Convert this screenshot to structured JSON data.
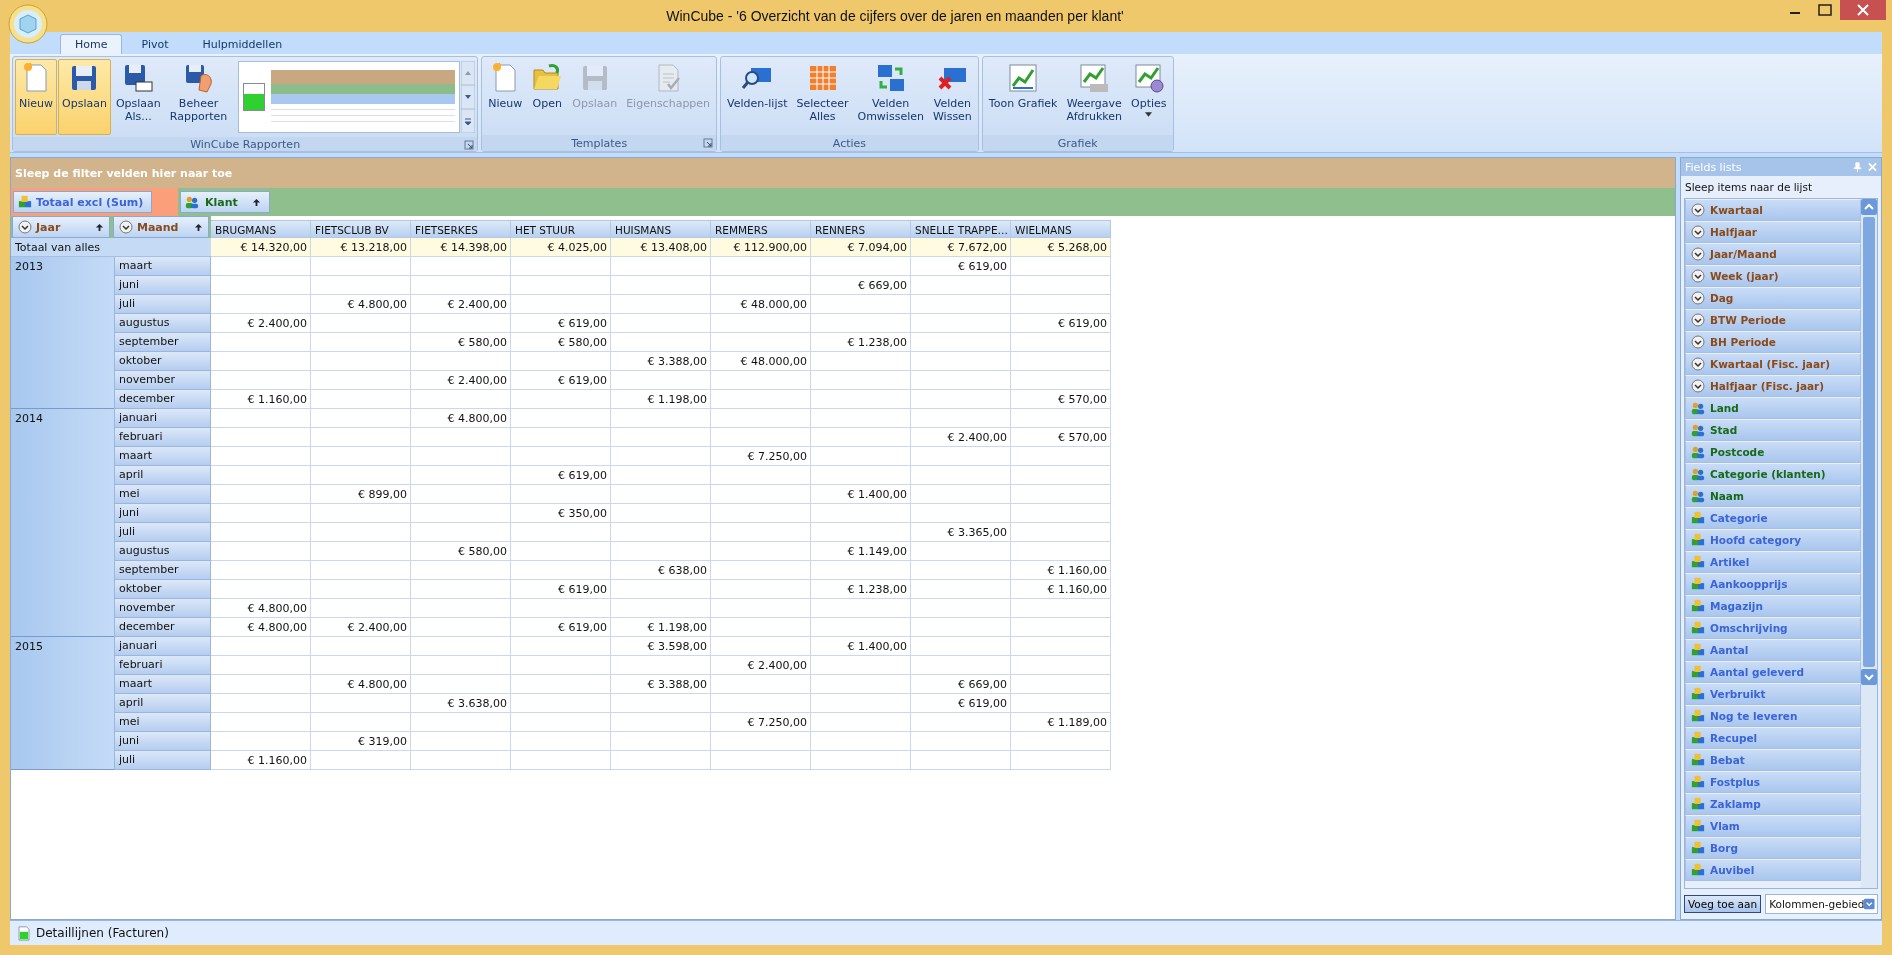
{
  "window": {
    "title": "WinCube - '6 Overzicht van de cijfers over de jaren en maanden per klant'"
  },
  "tabs": [
    {
      "label": "Home",
      "selected": true
    },
    {
      "label": "Pivot",
      "selected": false
    },
    {
      "label": "Hulpmiddellen",
      "selected": false
    }
  ],
  "ribbon_groups": [
    {
      "label": "WinCube Rapporten",
      "launcher": true,
      "buttons": [
        {
          "lines": [
            "Nieuw"
          ],
          "kind": "new",
          "highlighted": true,
          "disabled": false,
          "dropdown": false
        },
        {
          "lines": [
            "Opslaan"
          ],
          "kind": "save",
          "highlighted": true,
          "disabled": false,
          "dropdown": false
        },
        {
          "lines": [
            "Opslaan",
            "Als..."
          ],
          "kind": "saveas",
          "highlighted": false,
          "disabled": false,
          "dropdown": false
        },
        {
          "lines": [
            "Beheer",
            "Rapporten"
          ],
          "kind": "manage",
          "highlighted": false,
          "disabled": false,
          "dropdown": false
        }
      ]
    },
    {
      "label": "Templates",
      "launcher": true,
      "buttons": [
        {
          "lines": [
            "Nieuw"
          ],
          "kind": "new",
          "highlighted": false,
          "disabled": false,
          "dropdown": false
        },
        {
          "lines": [
            "Open"
          ],
          "kind": "open",
          "highlighted": false,
          "disabled": false,
          "dropdown": false
        },
        {
          "lines": [
            "Opslaan"
          ],
          "kind": "save",
          "highlighted": false,
          "disabled": true,
          "dropdown": false
        },
        {
          "lines": [
            "Eigenschappen"
          ],
          "kind": "props",
          "highlighted": false,
          "disabled": true,
          "dropdown": false
        }
      ]
    },
    {
      "label": "Acties",
      "launcher": false,
      "buttons": [
        {
          "lines": [
            "Velden-lijst"
          ],
          "kind": "find",
          "highlighted": false,
          "disabled": false,
          "dropdown": false
        },
        {
          "lines": [
            "Selecteer",
            "Alles"
          ],
          "kind": "grid",
          "highlighted": false,
          "disabled": false,
          "dropdown": false
        },
        {
          "lines": [
            "Velden",
            "Omwisselen"
          ],
          "kind": "swap",
          "highlighted": false,
          "disabled": false,
          "dropdown": false
        },
        {
          "lines": [
            "Velden",
            "Wissen"
          ],
          "kind": "clear",
          "highlighted": false,
          "disabled": false,
          "dropdown": false
        }
      ]
    },
    {
      "label": "Grafiek",
      "launcher": false,
      "buttons": [
        {
          "lines": [
            "Toon Grafiek"
          ],
          "kind": "chart",
          "highlighted": false,
          "disabled": false,
          "dropdown": false
        },
        {
          "lines": [
            "Weergave",
            "Afdrukken"
          ],
          "kind": "chartprint",
          "highlighted": false,
          "disabled": false,
          "dropdown": false
        },
        {
          "lines": [
            "Opties"
          ],
          "kind": "options",
          "highlighted": false,
          "disabled": false,
          "dropdown": true
        }
      ]
    }
  ],
  "pivot": {
    "filter_area": "Sleep de filter velden hier naar toe",
    "data_field": "Totaal excl (Sum)",
    "column_field": "Klant",
    "row_fields": [
      "Jaar",
      "Maand"
    ],
    "columns": [
      "BRUGMANS",
      "FIETSCLUB BV",
      "FIETSERKES",
      "HET STUUR",
      "HUISMANS",
      "REMMERS",
      "RENNERS",
      "SNELLE TRAPPE…",
      "WIELMANS"
    ],
    "grand_total": {
      "label": "Totaal van alles",
      "cells": [
        "€ 14.320,00",
        "€ 13.218,00",
        "€ 14.398,00",
        "€ 4.025,00",
        "€ 13.408,00",
        "€ 112.900,00",
        "€ 7.094,00",
        "€ 7.672,00",
        "€ 5.268,00"
      ]
    },
    "years": [
      {
        "year": "2013",
        "months": [
          {
            "month": "maart",
            "cells": [
              null,
              null,
              null,
              null,
              null,
              null,
              null,
              "€ 619,00",
              null
            ]
          },
          {
            "month": "juni",
            "cells": [
              null,
              null,
              null,
              null,
              null,
              null,
              "€ 669,00",
              null,
              null
            ]
          },
          {
            "month": "juli",
            "cells": [
              null,
              "€ 4.800,00",
              "€ 2.400,00",
              null,
              null,
              "€ 48.000,00",
              null,
              null,
              null
            ]
          },
          {
            "month": "augustus",
            "cells": [
              "€ 2.400,00",
              null,
              null,
              "€ 619,00",
              null,
              null,
              null,
              null,
              "€ 619,00"
            ]
          },
          {
            "month": "september",
            "cells": [
              null,
              null,
              "€ 580,00",
              "€ 580,00",
              null,
              null,
              "€ 1.238,00",
              null,
              null
            ]
          },
          {
            "month": "oktober",
            "cells": [
              null,
              null,
              null,
              null,
              "€ 3.388,00",
              "€ 48.000,00",
              null,
              null,
              null
            ]
          },
          {
            "month": "november",
            "cells": [
              null,
              null,
              "€ 2.400,00",
              "€ 619,00",
              null,
              null,
              null,
              null,
              null
            ]
          },
          {
            "month": "december",
            "cells": [
              "€ 1.160,00",
              null,
              null,
              null,
              "€ 1.198,00",
              null,
              null,
              null,
              "€ 570,00"
            ]
          }
        ]
      },
      {
        "year": "2014",
        "months": [
          {
            "month": "januari",
            "cells": [
              null,
              null,
              "€ 4.800,00",
              null,
              null,
              null,
              null,
              null,
              null
            ]
          },
          {
            "month": "februari",
            "cells": [
              null,
              null,
              null,
              null,
              null,
              null,
              null,
              "€ 2.400,00",
              "€ 570,00"
            ]
          },
          {
            "month": "maart",
            "cells": [
              null,
              null,
              null,
              null,
              null,
              "€ 7.250,00",
              null,
              null,
              null
            ]
          },
          {
            "month": "april",
            "cells": [
              null,
              null,
              null,
              "€ 619,00",
              null,
              null,
              null,
              null,
              null
            ]
          },
          {
            "month": "mei",
            "cells": [
              null,
              "€ 899,00",
              null,
              null,
              null,
              null,
              "€ 1.400,00",
              null,
              null
            ]
          },
          {
            "month": "juni",
            "cells": [
              null,
              null,
              null,
              "€ 350,00",
              null,
              null,
              null,
              null,
              null
            ]
          },
          {
            "month": "juli",
            "cells": [
              null,
              null,
              null,
              null,
              null,
              null,
              null,
              "€ 3.365,00",
              null
            ]
          },
          {
            "month": "augustus",
            "cells": [
              null,
              null,
              "€ 580,00",
              null,
              null,
              null,
              "€ 1.149,00",
              null,
              null
            ]
          },
          {
            "month": "september",
            "cells": [
              null,
              null,
              null,
              null,
              "€ 638,00",
              null,
              null,
              null,
              "€ 1.160,00"
            ]
          },
          {
            "month": "oktober",
            "cells": [
              null,
              null,
              null,
              "€ 619,00",
              null,
              null,
              "€ 1.238,00",
              null,
              "€ 1.160,00"
            ]
          },
          {
            "month": "november",
            "cells": [
              "€ 4.800,00",
              null,
              null,
              null,
              null,
              null,
              null,
              null,
              null
            ]
          },
          {
            "month": "december",
            "cells": [
              "€ 4.800,00",
              "€ 2.400,00",
              null,
              "€ 619,00",
              "€ 1.198,00",
              null,
              null,
              null,
              null
            ]
          }
        ]
      },
      {
        "year": "2015",
        "months": [
          {
            "month": "januari",
            "cells": [
              null,
              null,
              null,
              null,
              "€ 3.598,00",
              null,
              "€ 1.400,00",
              null,
              null
            ]
          },
          {
            "month": "februari",
            "cells": [
              null,
              null,
              null,
              null,
              null,
              "€ 2.400,00",
              null,
              null,
              null
            ]
          },
          {
            "month": "maart",
            "cells": [
              null,
              "€ 4.800,00",
              null,
              null,
              "€ 3.388,00",
              null,
              null,
              "€ 669,00",
              null
            ]
          },
          {
            "month": "april",
            "cells": [
              null,
              null,
              "€ 3.638,00",
              null,
              null,
              null,
              null,
              "€ 619,00",
              null
            ]
          },
          {
            "month": "mei",
            "cells": [
              null,
              null,
              null,
              null,
              null,
              "€ 7.250,00",
              null,
              null,
              "€ 1.189,00"
            ]
          },
          {
            "month": "juni",
            "cells": [
              null,
              "€ 319,00",
              null,
              null,
              null,
              null,
              null,
              null,
              null
            ]
          },
          {
            "month": "juli",
            "cells": [
              "€ 1.160,00",
              null,
              null,
              null,
              null,
              null,
              null,
              null,
              null
            ]
          }
        ]
      }
    ]
  },
  "fields_panel": {
    "title": "Fields lists",
    "hint": "Sleep items naar de lijst",
    "items": [
      {
        "label": "Kwartaal",
        "kind": "date"
      },
      {
        "label": "Halfjaar",
        "kind": "date"
      },
      {
        "label": "Jaar/Maand",
        "kind": "date"
      },
      {
        "label": "Week (jaar)",
        "kind": "date"
      },
      {
        "label": "Dag",
        "kind": "date"
      },
      {
        "label": "BTW Periode",
        "kind": "date"
      },
      {
        "label": "BH Periode",
        "kind": "date"
      },
      {
        "label": "Kwartaal (Fisc. jaar)",
        "kind": "date"
      },
      {
        "label": "Halfjaar (Fisc. jaar)",
        "kind": "date"
      },
      {
        "label": "Land",
        "kind": "customer"
      },
      {
        "label": "Stad",
        "kind": "customer"
      },
      {
        "label": "Postcode",
        "kind": "customer"
      },
      {
        "label": "Categorie (klanten)",
        "kind": "customer"
      },
      {
        "label": "Naam",
        "kind": "customer"
      },
      {
        "label": "Categorie",
        "kind": "measure"
      },
      {
        "label": "Hoofd category",
        "kind": "measure"
      },
      {
        "label": "Artikel",
        "kind": "measure"
      },
      {
        "label": "Aankoopprijs",
        "kind": "measure"
      },
      {
        "label": "Magazijn",
        "kind": "measure"
      },
      {
        "label": "Omschrijving",
        "kind": "measure"
      },
      {
        "label": "Aantal",
        "kind": "measure"
      },
      {
        "label": "Aantal geleverd",
        "kind": "measure"
      },
      {
        "label": "Verbruikt",
        "kind": "measure"
      },
      {
        "label": "Nog te leveren",
        "kind": "measure"
      },
      {
        "label": "Recupel",
        "kind": "measure"
      },
      {
        "label": "Bebat",
        "kind": "measure"
      },
      {
        "label": "Fostplus",
        "kind": "measure"
      },
      {
        "label": "Zaklamp",
        "kind": "measure"
      },
      {
        "label": "Vlam",
        "kind": "measure"
      },
      {
        "label": "Borg",
        "kind": "measure"
      },
      {
        "label": "Auvibel",
        "kind": "measure"
      }
    ],
    "add_button": "Voeg toe aan",
    "area_select": "Kolommen-gebied"
  },
  "status_bar": {
    "text": "Detaillijnen (Facturen)"
  }
}
